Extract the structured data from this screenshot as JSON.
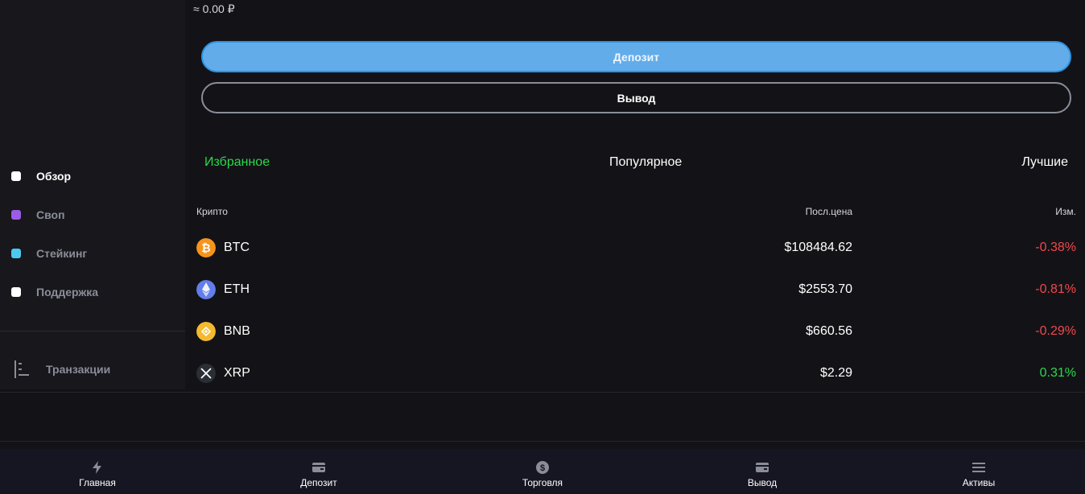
{
  "balance": {
    "approx": "≈ 0.00 ₽"
  },
  "actions": {
    "deposit": "Депозит",
    "withdraw": "Вывод"
  },
  "sidebar": {
    "items": [
      {
        "label": "Обзор",
        "color": "#ffffff",
        "active": true
      },
      {
        "label": "Своп",
        "color": "#9b5de5"
      },
      {
        "label": "Стейкинг",
        "color": "#4cc9f0"
      },
      {
        "label": "Поддержка",
        "color": "#ffffff"
      }
    ],
    "transactions": "Транзакции"
  },
  "tabs": [
    {
      "label": "Избранное",
      "active": true
    },
    {
      "label": "Популярное"
    },
    {
      "label": "Лучшие"
    }
  ],
  "table": {
    "headers": {
      "asset": "Крипто",
      "price": "Посл.цена",
      "change": "Изм."
    },
    "rows": [
      {
        "symbol": "BTC",
        "price": "$108484.62",
        "change": "-0.38%",
        "trend": "down",
        "icon": "bitcoin-icon",
        "color": "#f7931a"
      },
      {
        "symbol": "ETH",
        "price": "$2553.70",
        "change": "-0.81%",
        "trend": "down",
        "icon": "ethereum-icon",
        "color": "#627eea"
      },
      {
        "symbol": "BNB",
        "price": "$660.56",
        "change": "-0.29%",
        "trend": "down",
        "icon": "bnb-icon",
        "color": "#f3ba2f"
      },
      {
        "symbol": "XRP",
        "price": "$2.29",
        "change": "0.31%",
        "trend": "up",
        "icon": "xrp-icon",
        "color": "#23292f"
      }
    ]
  },
  "colors": {
    "up": "#2bd94a",
    "down": "#f0474d",
    "accent": "#63acea"
  },
  "nav": [
    {
      "label": "Главная",
      "icon": "lightning-icon"
    },
    {
      "label": "Депозит",
      "icon": "wallet-icon"
    },
    {
      "label": "Торговля",
      "icon": "dollar-circle-icon"
    },
    {
      "label": "Вывод",
      "icon": "wallet-out-icon"
    },
    {
      "label": "Активы",
      "icon": "menu-icon"
    }
  ]
}
